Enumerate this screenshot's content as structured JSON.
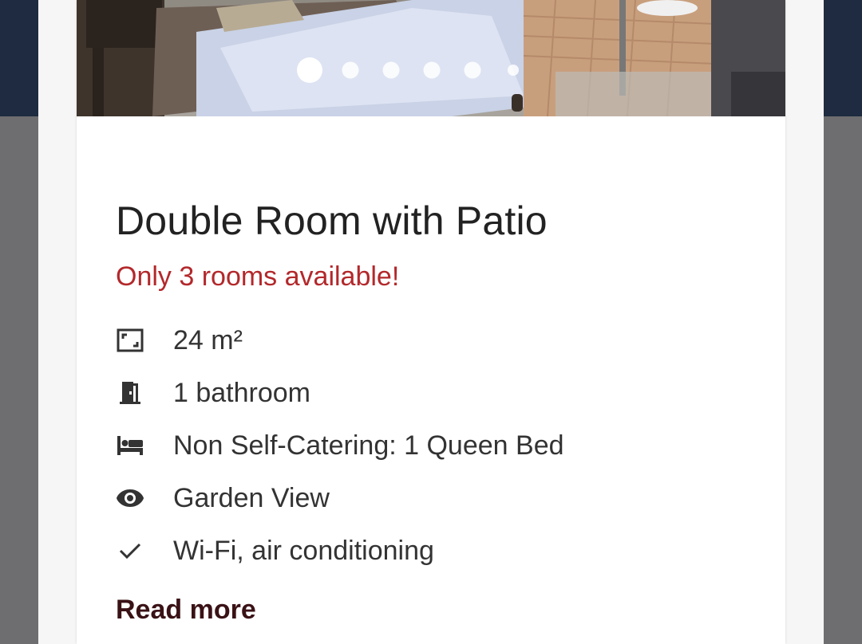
{
  "room": {
    "title": "Double Room with Patio",
    "availability": "Only 3 rooms available!",
    "features": [
      {
        "icon": "room-size-icon",
        "text": "24 m²"
      },
      {
        "icon": "bathroom-door-icon",
        "text": "1 bathroom"
      },
      {
        "icon": "bed-icon",
        "text": "Non Self-Catering: 1 Queen Bed"
      },
      {
        "icon": "eye-icon",
        "text": "Garden View"
      },
      {
        "icon": "checkmark-icon",
        "text": "Wi-Fi, air conditioning"
      }
    ],
    "read_more": "Read more"
  },
  "gallery": {
    "dot_count": 6,
    "active_index": 0
  },
  "colors": {
    "availability": "#b3282b",
    "read_more": "#3a1216",
    "header_bg": "#1e2b40"
  }
}
